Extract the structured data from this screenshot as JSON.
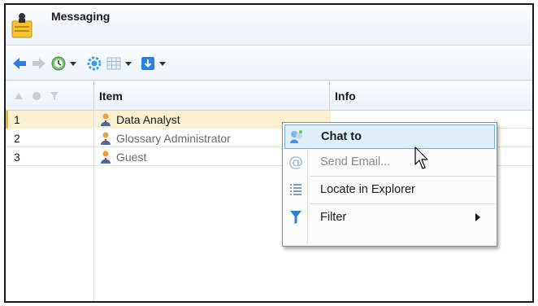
{
  "window": {
    "title": "Messaging"
  },
  "toolbar": {
    "icons": [
      "back-arrow-icon",
      "forward-arrow-icon",
      "history-icon",
      "settings-gear-icon",
      "table-view-icon",
      "download-icon"
    ]
  },
  "grid": {
    "header_icons": [
      "sort-up-icon",
      "status-circle-icon",
      "filter-icon"
    ],
    "columns": [
      "Item",
      "Info"
    ],
    "rows": [
      {
        "num": "1",
        "item": "Data Analyst"
      },
      {
        "num": "2",
        "item": "Glossary Administrator"
      },
      {
        "num": "3",
        "item": "Guest"
      }
    ]
  },
  "context_menu": {
    "items": [
      {
        "label": "Chat to",
        "icon": "chat-users-icon"
      },
      {
        "label": "Send Email...",
        "icon": "at-sign-icon"
      },
      {
        "label": "Locate in Explorer",
        "icon": "list-icon"
      },
      {
        "label": "Filter",
        "icon": "filter-funnel-icon"
      }
    ]
  },
  "colors": {
    "accent": "#1f6fc9",
    "selected_row": "#fbf1d0",
    "selected_marker": "#f2b316",
    "menu_highlight": "#dfeefb"
  }
}
